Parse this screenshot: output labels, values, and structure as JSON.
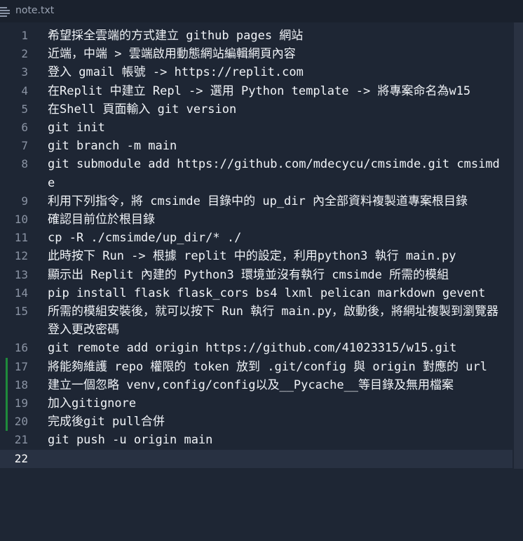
{
  "tab": {
    "title": "note.txt",
    "icon": "file-lines-icon"
  },
  "colors": {
    "background": "#1e2634",
    "text": "#f0f3f7",
    "line_number": "#8a93a3",
    "modified_gutter": "#1f8a3b",
    "current_line": "#283142"
  },
  "editor": {
    "current_line": 22,
    "lines": [
      {
        "num": "1",
        "text": "希望採全雲端的方式建立 github pages 網站"
      },
      {
        "num": "2",
        "text": "近端，中端 > 雲端啟用動態網站編輯網頁內容"
      },
      {
        "num": "3",
        "text": "登入 gmail 帳號 -> https://replit.com"
      },
      {
        "num": "4",
        "text": "在Replit 中建立 Repl -> 選用 Python template -> 將專案命名為w15"
      },
      {
        "num": "5",
        "text": "在Shell 頁面輸入 git version"
      },
      {
        "num": "6",
        "text": "git init"
      },
      {
        "num": "7",
        "text": "git branch -m main"
      },
      {
        "num": "8",
        "text": "git submodule add https://github.com/mdecycu/cmsimde.git cmsimde"
      },
      {
        "num": "9",
        "text": "利用下列指令，將 cmsimde 目錄中的 up_dir 內全部資料複製道專案根目錄"
      },
      {
        "num": "10",
        "text": "確認目前位於根目錄"
      },
      {
        "num": "11",
        "text": "cp -R ./cmsimde/up_dir/* ./"
      },
      {
        "num": "12",
        "text": "此時按下 Run -> 根據 replit 中的設定，利用python3 執行 main.py"
      },
      {
        "num": "13",
        "text": "顯示出 Replit 內建的 Python3 環境並沒有執行 cmsimde 所需的模組"
      },
      {
        "num": "14",
        "text": "pip install flask flask_cors bs4 lxml pelican markdown gevent"
      },
      {
        "num": "15",
        "text": "所需的模組安裝後，就可以按下 Run 執行 main.py，啟動後，將網址複製到瀏覽器登入更改密碼"
      },
      {
        "num": "16",
        "text": "git remote add origin https://github.com/41023315/w15.git"
      },
      {
        "num": "17",
        "text": "將能夠維護 repo 權限的 token 放到 .git/config 與 origin 對應的 url",
        "modified": true
      },
      {
        "num": "18",
        "text": "建立一個忽略 venv,config/config以及__Pycache__等目錄及無用檔案",
        "modified": true
      },
      {
        "num": "19",
        "text": "加入gitignore",
        "modified": true
      },
      {
        "num": "20",
        "text": "完成後git pull合併",
        "modified": true
      },
      {
        "num": "21",
        "text": "git push -u origin main"
      },
      {
        "num": "22",
        "text": ""
      }
    ]
  }
}
